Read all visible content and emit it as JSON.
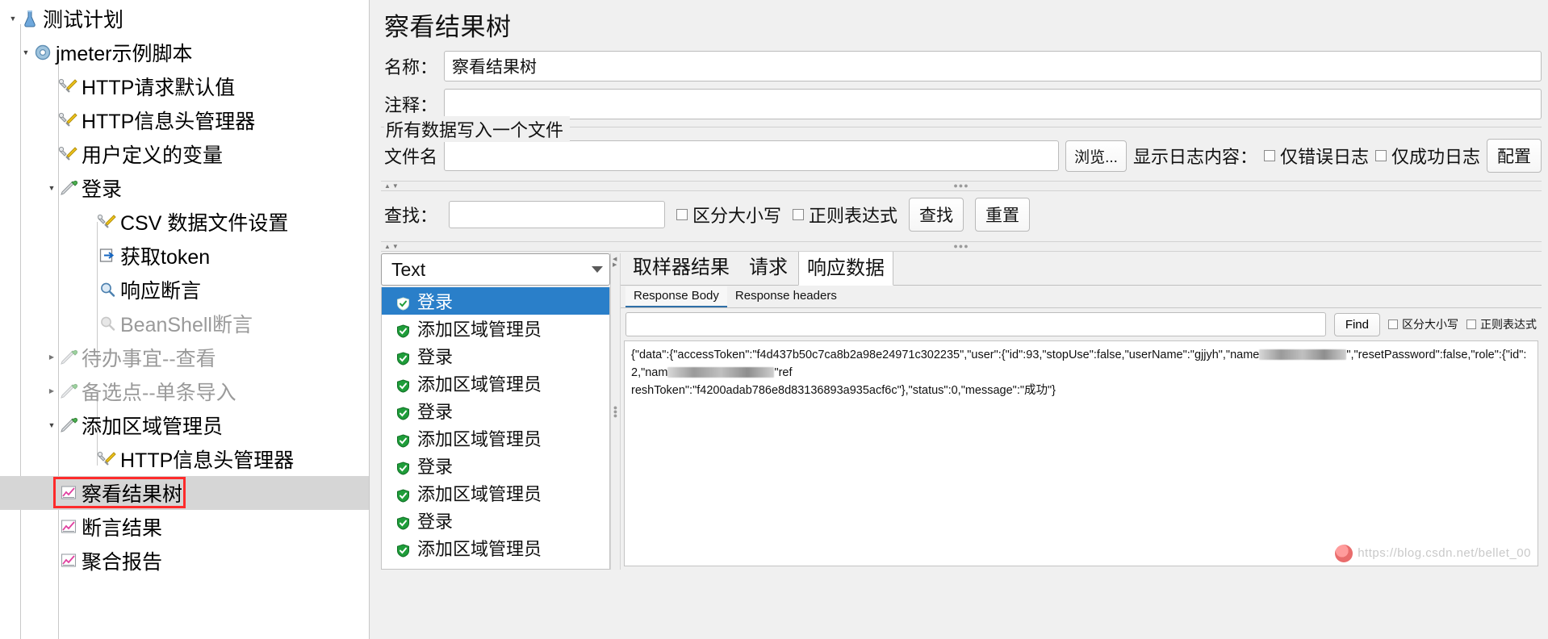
{
  "tree": {
    "items": [
      {
        "label": "测试计划",
        "icon": "test-plan-icon",
        "indent": 0,
        "twisty": "open",
        "disabled": false,
        "selected": false
      },
      {
        "label": "jmeter示例脚本",
        "icon": "thread-group-icon",
        "indent": 1,
        "twisty": "open",
        "disabled": false,
        "selected": false
      },
      {
        "label": "HTTP请求默认值",
        "icon": "config-wrench-icon",
        "indent": 2,
        "twisty": "none",
        "disabled": false,
        "selected": false
      },
      {
        "label": "HTTP信息头管理器",
        "icon": "config-wrench-icon",
        "indent": 2,
        "twisty": "none",
        "disabled": false,
        "selected": false
      },
      {
        "label": "用户定义的变量",
        "icon": "config-wrench-icon",
        "indent": 2,
        "twisty": "none",
        "disabled": false,
        "selected": false
      },
      {
        "label": "登录",
        "icon": "transaction-pencil-icon",
        "indent": 2,
        "twisty": "open",
        "disabled": false,
        "selected": false
      },
      {
        "label": "CSV 数据文件设置",
        "icon": "config-wrench-icon",
        "indent": 3,
        "twisty": "none",
        "disabled": false,
        "selected": false
      },
      {
        "label": "获取token",
        "icon": "http-request-icon",
        "indent": 3,
        "twisty": "none",
        "disabled": false,
        "selected": false
      },
      {
        "label": "响应断言",
        "icon": "assertion-magnifier-icon",
        "indent": 3,
        "twisty": "none",
        "disabled": false,
        "selected": false
      },
      {
        "label": "BeanShell断言",
        "icon": "assertion-magnifier-icon",
        "indent": 3,
        "twisty": "none",
        "disabled": true,
        "selected": false
      },
      {
        "label": "待办事宜--查看",
        "icon": "transaction-pencil-icon",
        "indent": 2,
        "twisty": "closed",
        "disabled": true,
        "selected": false
      },
      {
        "label": "备选点--单条导入",
        "icon": "transaction-pencil-icon",
        "indent": 2,
        "twisty": "closed",
        "disabled": true,
        "selected": false
      },
      {
        "label": "添加区域管理员",
        "icon": "transaction-pencil-icon",
        "indent": 2,
        "twisty": "open",
        "disabled": false,
        "selected": false
      },
      {
        "label": "HTTP信息头管理器",
        "icon": "config-wrench-icon",
        "indent": 3,
        "twisty": "none",
        "disabled": false,
        "selected": false
      },
      {
        "label": "察看结果树",
        "icon": "listener-graph-icon",
        "indent": 2,
        "twisty": "none",
        "disabled": false,
        "selected": true
      },
      {
        "label": "断言结果",
        "icon": "listener-graph-icon",
        "indent": 2,
        "twisty": "none",
        "disabled": false,
        "selected": false
      },
      {
        "label": "聚合报告",
        "icon": "listener-graph-icon",
        "indent": 2,
        "twisty": "none",
        "disabled": false,
        "selected": false
      }
    ]
  },
  "main": {
    "page_title": "察看结果树",
    "name_label": "名称：",
    "name_value": "察看结果树",
    "comment_label": "注释：",
    "comment_value": "",
    "group_title": "所有数据写入一个文件",
    "filename_label": "文件名",
    "filename_value": "",
    "browse_button": "浏览...",
    "log_display_label": "显示日志内容：",
    "only_errors_label": "仅错误日志",
    "only_success_label": "仅成功日志",
    "configure_button": "配置",
    "search": {
      "label": "查找：",
      "value": "",
      "case_sensitive_label": "区分大小写",
      "regex_label": "正则表达式",
      "find_button": "查找",
      "reset_button": "重置"
    }
  },
  "results": {
    "render_selected": "Text",
    "items": [
      {
        "label": "登录",
        "status": "success",
        "selected": true
      },
      {
        "label": "添加区域管理员",
        "status": "success",
        "selected": false
      },
      {
        "label": "登录",
        "status": "success",
        "selected": false
      },
      {
        "label": "添加区域管理员",
        "status": "success",
        "selected": false
      },
      {
        "label": "登录",
        "status": "success",
        "selected": false
      },
      {
        "label": "添加区域管理员",
        "status": "success",
        "selected": false
      },
      {
        "label": "登录",
        "status": "success",
        "selected": false
      },
      {
        "label": "添加区域管理员",
        "status": "success",
        "selected": false
      },
      {
        "label": "登录",
        "status": "success",
        "selected": false
      },
      {
        "label": "添加区域管理员",
        "status": "success",
        "selected": false
      }
    ]
  },
  "detail": {
    "tabs": [
      {
        "label": "取样器结果",
        "active": false
      },
      {
        "label": "请求",
        "active": false
      },
      {
        "label": "响应数据",
        "active": true
      }
    ],
    "subtabs": [
      {
        "label": "Response Body",
        "active": true
      },
      {
        "label": "Response headers",
        "active": false
      }
    ],
    "find": {
      "value": "",
      "find_button": "Find",
      "case_sensitive_label": "区分大小写",
      "regex_label": "正则表达式"
    },
    "response_line1_a": "{\"data\":{\"accessToken\":\"f4d437b50c7ca8b2a98e24971c302235\",\"user\":{\"id\":93,\"stopUse\":false,\"userName\":\"gjjyh\",\"name",
    "response_line1_b": "\",\"resetPassword\":false,\"role\":{\"id\":2,\"nam",
    "response_line1_c": "\"ref",
    "response_line2": "reshToken\":\"f4200adab786e8d83136893a935acf6c\"},\"status\":0,\"message\":\"成功\"}",
    "watermark": "https://blog.csdn.net/bellet_00"
  },
  "colors": {
    "selection_blue": "#2a7fc9",
    "tree_selection_gray": "#d6d6d6",
    "highlight_red": "#ff2b2b",
    "success_green": "#1f9d3a",
    "panel_bg": "#f0f0f0"
  }
}
